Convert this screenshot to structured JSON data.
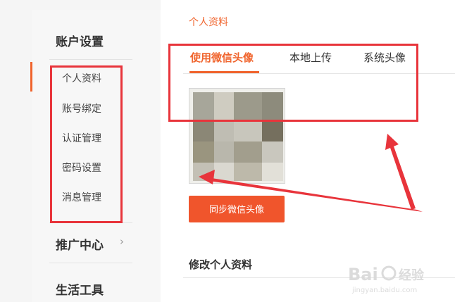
{
  "sidebar": {
    "account_section": "账户设置",
    "items": [
      {
        "label": "个人资料"
      },
      {
        "label": "账号绑定"
      },
      {
        "label": "认证管理"
      },
      {
        "label": "密码设置"
      },
      {
        "label": "消息管理"
      }
    ],
    "promo_section": "推广中心",
    "tools_section": "生活工具"
  },
  "main": {
    "title": "个人资料",
    "tabs": [
      {
        "label": "使用微信头像",
        "active": true
      },
      {
        "label": "本地上传",
        "active": false
      },
      {
        "label": "系统头像",
        "active": false
      }
    ],
    "sync_button": "同步微信头像",
    "edit_title": "修改个人资料"
  },
  "icons": {
    "promo_chevron": "chevron-right-icon"
  },
  "colors": {
    "accent": "#f0642d",
    "annotation_red": "#e8343b",
    "button": "#f0552c"
  }
}
